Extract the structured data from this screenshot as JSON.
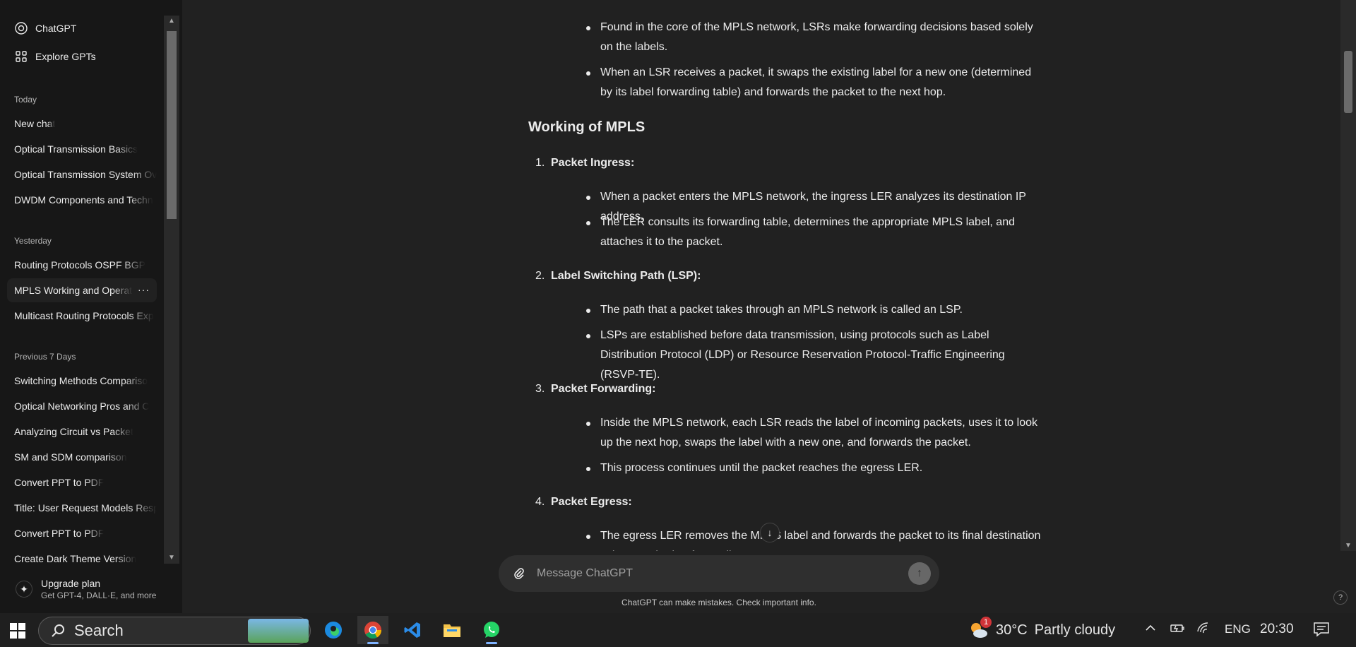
{
  "sidebar": {
    "top_links": [
      {
        "label": "ChatGPT",
        "icon": "openai-logo-icon"
      },
      {
        "label": "Explore GPTs",
        "icon": "grid-icon"
      }
    ],
    "sections": [
      {
        "title": "Today",
        "items": [
          "New chat",
          "Optical Transmission Basics",
          "Optical Transmission System Ov",
          "DWDM Components and Techn"
        ]
      },
      {
        "title": "Yesterday",
        "items": [
          "Routing Protocols OSPF BGP",
          "MPLS Working and Operatio",
          "Multicast Routing Protocols Exp"
        ]
      },
      {
        "title": "Previous 7 Days",
        "items": [
          "Switching Methods Compariso",
          "Optical Networking Pros and C",
          "Analyzing Circuit vs Packet",
          "SM and SDM comparison",
          "Convert PPT to PDF",
          "Title: User Request Models Resp",
          "Convert PPT to PDF",
          "Create Dark Theme Version"
        ]
      }
    ],
    "active_item_options": "···",
    "upgrade": {
      "title": "Upgrade plan",
      "subtitle": "Get GPT-4, DALL·E, and more"
    }
  },
  "content": {
    "lsr_bullets": [
      "Found in the core of the MPLS network, LSRs make forwarding decisions based solely on the labels.",
      "When an LSR receives a packet, it swaps the existing label for a new one (determined by its label forwarding table) and forwards the packet to the next hop."
    ],
    "heading": "Working of MPLS",
    "steps": [
      {
        "num": "1.",
        "title": "Packet Ingress",
        "bullets": [
          "When a packet enters the MPLS network, the ingress LER analyzes its destination IP address.",
          "The LER consults its forwarding table, determines the appropriate MPLS label, and attaches it to the packet."
        ]
      },
      {
        "num": "2.",
        "title": "Label Switching Path (LSP)",
        "bullets": [
          "The path that a packet takes through an MPLS network is called an LSP.",
          "LSPs are established before data transmission, using protocols such as Label Distribution Protocol (LDP) or Resource Reservation Protocol-Traffic Engineering (RSVP-TE)."
        ]
      },
      {
        "num": "3.",
        "title": "Packet Forwarding",
        "bullets": [
          "Inside the MPLS network, each LSR reads the label of incoming packets, uses it to look up the next hop, swaps the label with a new one, and forwards the packet.",
          "This process continues until the packet reaches the egress LER."
        ]
      },
      {
        "num": "4.",
        "title": "Packet Egress",
        "bullets": [
          "The egress LER removes the MPLS label and forwards the packet to its final destination using standard IP forwarding."
        ]
      }
    ]
  },
  "composer": {
    "placeholder": "Message ChatGPT"
  },
  "disclaimer": "ChatGPT can make mistakes. Check important info.",
  "help": "?",
  "taskbar": {
    "search_label": "Search",
    "weather": {
      "temp": "30°C",
      "condition": "Partly cloudy",
      "badge": "1"
    },
    "language": "ENG",
    "time": "20:30",
    "apps": [
      "edge-icon",
      "chrome-icon",
      "vscode-icon",
      "file-explorer-icon",
      "whatsapp-icon"
    ]
  }
}
